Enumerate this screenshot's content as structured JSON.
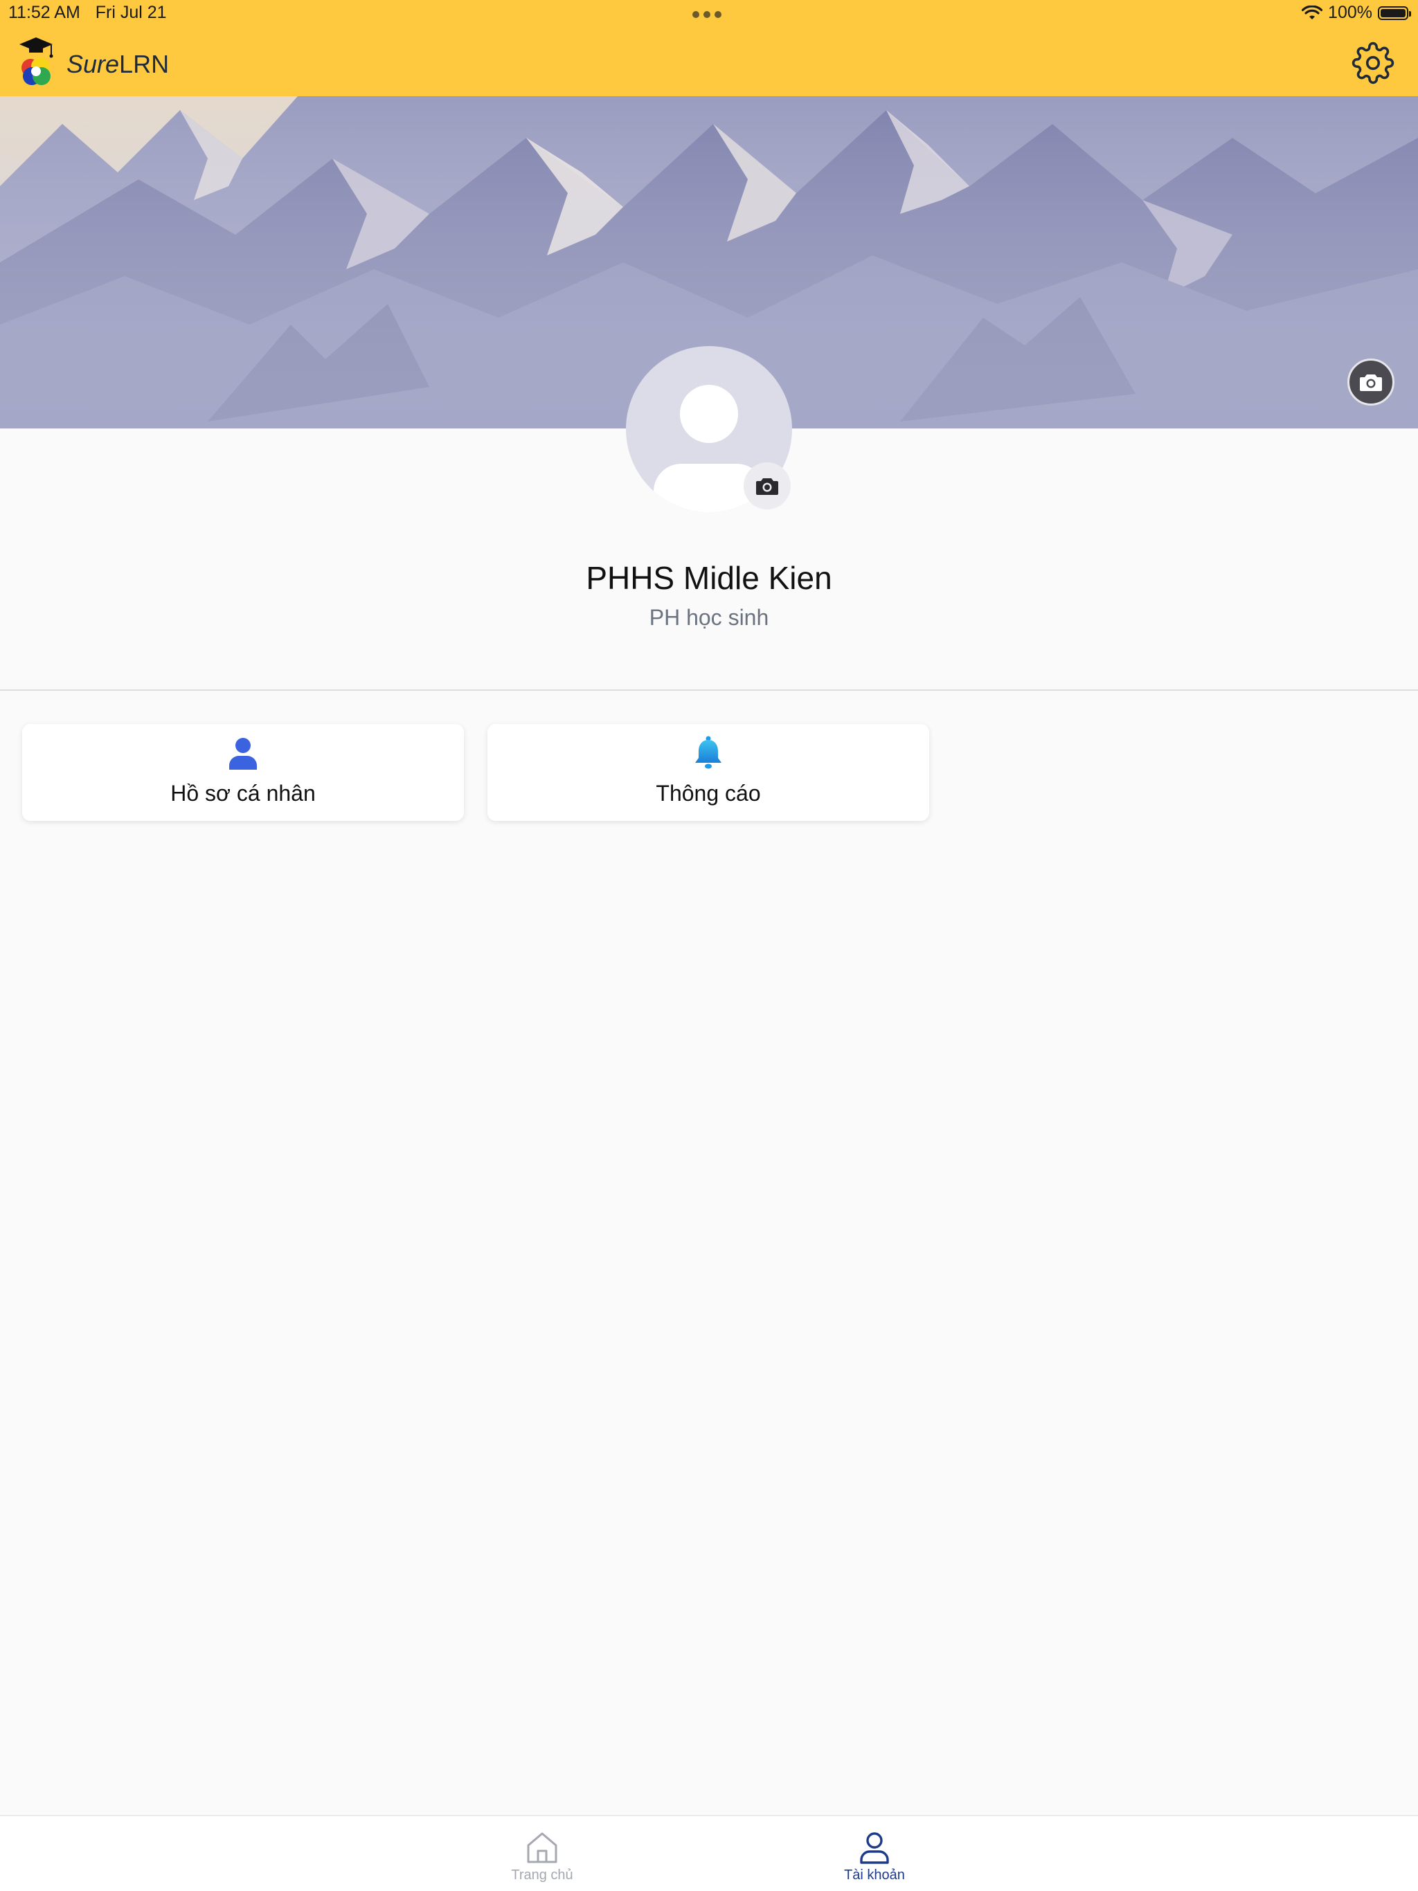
{
  "status_bar": {
    "time": "11:52 AM",
    "date": "Fri Jul 21",
    "battery": "100%"
  },
  "header": {
    "app_name_italic": "Sure",
    "app_name_bold": "LRN"
  },
  "profile": {
    "name": "PHHS Midle Kien",
    "role": "PH học sinh"
  },
  "cards": [
    {
      "label": "Hồ sơ cá nhân",
      "icon": "person-icon"
    },
    {
      "label": "Thông cáo",
      "icon": "bell-icon"
    }
  ],
  "bottom_nav": {
    "items": [
      {
        "label": "Trang chủ",
        "icon": "home-icon",
        "active": false
      },
      {
        "label": "Tài khoản",
        "icon": "user-icon",
        "active": true
      }
    ]
  },
  "colors": {
    "header_bg": "#fec93e",
    "active_nav": "#1e3a8a",
    "inactive_nav": "#a5a8b0",
    "person_icon": "#3b63e0",
    "bell_icon": "#1e9be8"
  }
}
